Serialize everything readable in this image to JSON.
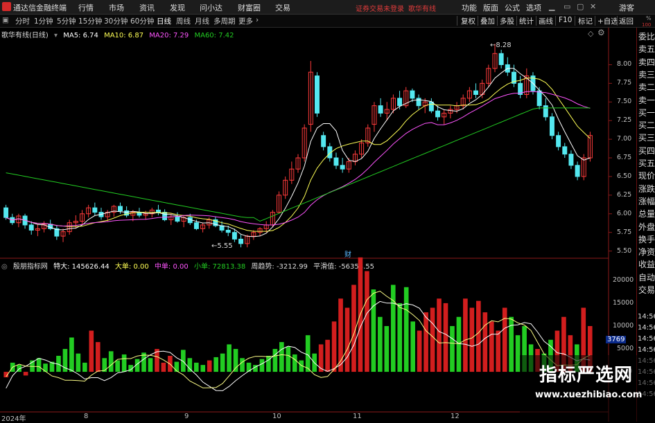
{
  "titlebar": {
    "app_title": "通达信金融终端",
    "menu": [
      "行情",
      "市场",
      "资讯",
      "发现",
      "问小达",
      "财富圈",
      "交易"
    ],
    "notice": "证券交易未登录",
    "stock_name": "歌华有线",
    "right_menu": [
      "功能",
      "版面",
      "公式",
      "选项"
    ],
    "guest": "游客"
  },
  "toolbar": {
    "periods": [
      "分时",
      "1分钟",
      "5分钟",
      "15分钟",
      "30分钟",
      "60分钟",
      "日线",
      "周线",
      "月线",
      "多周期",
      "更多"
    ],
    "active_period": "日线",
    "right_buttons": [
      "复权",
      "叠加",
      "多股",
      "统计",
      "画线",
      "F10",
      "标记",
      "+自选",
      "返回"
    ]
  },
  "main_chart": {
    "stock_title": "歌华有线(日线)",
    "ma5": "MA5: 6.74",
    "ma10": "MA10: 6.87",
    "ma20": "MA20: 7.29",
    "ma60": "MA60: 7.42",
    "high_marker": "8.28",
    "low_marker": "5.55",
    "event_marker": "财",
    "y_ticks": [
      "8.00",
      "7.75",
      "7.50",
      "7.25",
      "7.00",
      "6.75",
      "6.50",
      "6.25",
      "6.00",
      "5.75",
      "5.50"
    ],
    "corner_labels": [
      "%",
      "100"
    ]
  },
  "sub_chart": {
    "title": "殷朋指标网",
    "tedа": "特大: 145626.44",
    "dadan": "大单: 0.00",
    "zhongdan": "中单: 0.00",
    "xiaodan": "小单: 72813.38",
    "zhouqushi": "周趋势: -3212.99",
    "pinghuazhi": "平滑值: -56353.55",
    "y_ticks": [
      "20000",
      "15000",
      "10000",
      "5000",
      "0"
    ],
    "highlight_value": "3769"
  },
  "x_axis": [
    "2024年",
    "8",
    "9",
    "10",
    "11",
    "12"
  ],
  "right_panel": {
    "items": [
      "委比",
      "卖五",
      "卖四",
      "卖三",
      "卖二",
      "卖一",
      "买一",
      "买二",
      "买三",
      "买四",
      "买五",
      "现价",
      "涨跌",
      "涨幅",
      "总量",
      "外盘",
      "换手",
      "净资",
      "收益",
      "自动",
      "交易"
    ],
    "times": [
      "14:56",
      "14:56",
      "14:56",
      "14:56",
      "14:56",
      "14:56",
      "14:56",
      "14:56"
    ]
  },
  "watermark": {
    "line1": "指标严选网",
    "line2": "www.xuezhibiao.com"
  },
  "colors": {
    "up": "#ff3b3b",
    "down": "#54e8f0",
    "ma5": "#ffffff",
    "ma10": "#ffff55",
    "ma20": "#ff55ff",
    "ma60": "#22cc22",
    "vol_red": "#d21e1e",
    "vol_green": "#22cc22"
  },
  "chart_data": [
    {
      "type": "candlestick",
      "title": "歌华有线(日线)",
      "x_labels": [
        "2024年",
        "8",
        "9",
        "10",
        "11",
        "12"
      ],
      "ylim": [
        5.45,
        8.45
      ],
      "ohlc": [
        [
          6.08,
          6.12,
          5.92,
          5.95
        ],
        [
          5.95,
          6.0,
          5.85,
          5.88
        ],
        [
          5.88,
          6.0,
          5.82,
          5.97
        ],
        [
          5.97,
          6.0,
          5.8,
          5.85
        ],
        [
          5.85,
          5.9,
          5.72,
          5.78
        ],
        [
          5.78,
          5.86,
          5.7,
          5.8
        ],
        [
          5.8,
          5.9,
          5.75,
          5.86
        ],
        [
          5.86,
          5.92,
          5.78,
          5.8
        ],
        [
          5.8,
          5.85,
          5.65,
          5.7
        ],
        [
          5.7,
          5.8,
          5.62,
          5.76
        ],
        [
          5.76,
          5.92,
          5.72,
          5.88
        ],
        [
          5.88,
          5.98,
          5.8,
          5.9
        ],
        [
          5.9,
          6.05,
          5.85,
          6.0
        ],
        [
          6.0,
          6.12,
          5.95,
          6.08
        ],
        [
          6.08,
          6.15,
          5.98,
          6.02
        ],
        [
          6.02,
          6.08,
          5.92,
          5.96
        ],
        [
          5.96,
          6.05,
          5.9,
          6.02
        ],
        [
          6.02,
          6.12,
          5.96,
          6.1
        ],
        [
          6.1,
          6.15,
          6.0,
          6.04
        ],
        [
          6.04,
          6.1,
          5.95,
          5.98
        ],
        [
          5.98,
          6.05,
          5.9,
          6.02
        ],
        [
          6.02,
          6.08,
          5.95,
          5.98
        ],
        [
          5.98,
          6.04,
          5.92,
          6.0
        ],
        [
          6.0,
          6.08,
          5.95,
          6.05
        ],
        [
          6.05,
          6.12,
          5.98,
          6.02
        ],
        [
          6.02,
          6.06,
          5.9,
          5.92
        ],
        [
          5.92,
          6.0,
          5.85,
          5.96
        ],
        [
          5.96,
          6.02,
          5.88,
          5.9
        ],
        [
          5.9,
          5.98,
          5.82,
          5.95
        ],
        [
          5.95,
          6.0,
          5.85,
          5.88
        ],
        [
          5.88,
          5.92,
          5.78,
          5.8
        ],
        [
          5.8,
          5.88,
          5.75,
          5.85
        ],
        [
          5.85,
          5.95,
          5.8,
          5.92
        ],
        [
          5.92,
          5.96,
          5.82,
          5.84
        ],
        [
          5.84,
          5.9,
          5.75,
          5.78
        ],
        [
          5.78,
          5.84,
          5.7,
          5.75
        ],
        [
          5.75,
          5.8,
          5.62,
          5.66
        ],
        [
          5.66,
          5.72,
          5.55,
          5.6
        ],
        [
          5.6,
          5.72,
          5.55,
          5.7
        ],
        [
          5.7,
          5.78,
          5.65,
          5.75
        ],
        [
          5.75,
          5.82,
          5.7,
          5.8
        ],
        [
          5.8,
          5.9,
          5.75,
          5.85
        ],
        [
          5.85,
          6.05,
          5.82,
          6.02
        ],
        [
          6.02,
          6.3,
          6.0,
          6.25
        ],
        [
          6.25,
          6.5,
          6.2,
          6.45
        ],
        [
          6.45,
          6.7,
          6.4,
          6.6
        ],
        [
          6.6,
          6.8,
          6.55,
          6.75
        ],
        [
          6.75,
          7.2,
          6.7,
          7.15
        ],
        [
          7.2,
          8.05,
          7.1,
          7.9
        ],
        [
          7.85,
          7.9,
          7.3,
          7.35
        ],
        [
          7.05,
          7.1,
          6.85,
          6.9
        ],
        [
          6.9,
          6.95,
          6.7,
          6.75
        ],
        [
          6.75,
          6.82,
          6.6,
          6.65
        ],
        [
          6.65,
          6.75,
          6.55,
          6.6
        ],
        [
          6.6,
          6.75,
          6.55,
          6.7
        ],
        [
          6.7,
          6.85,
          6.65,
          6.8
        ],
        [
          6.8,
          7.0,
          6.75,
          6.95
        ],
        [
          6.95,
          7.2,
          6.9,
          7.15
        ],
        [
          7.2,
          7.5,
          7.1,
          7.45
        ],
        [
          7.45,
          7.55,
          7.3,
          7.35
        ],
        [
          7.35,
          7.5,
          7.25,
          7.4
        ],
        [
          7.4,
          7.6,
          7.35,
          7.55
        ],
        [
          7.55,
          7.65,
          7.4,
          7.45
        ],
        [
          7.45,
          7.7,
          7.42,
          7.65
        ],
        [
          7.65,
          7.68,
          7.5,
          7.55
        ],
        [
          7.55,
          7.6,
          7.4,
          7.45
        ],
        [
          7.45,
          7.55,
          7.35,
          7.5
        ],
        [
          7.5,
          7.55,
          7.35,
          7.38
        ],
        [
          7.38,
          7.45,
          7.25,
          7.3
        ],
        [
          7.3,
          7.4,
          7.2,
          7.35
        ],
        [
          7.35,
          7.45,
          7.28,
          7.4
        ],
        [
          7.4,
          7.5,
          7.35,
          7.45
        ],
        [
          7.45,
          7.6,
          7.4,
          7.55
        ],
        [
          7.55,
          7.7,
          7.5,
          7.65
        ],
        [
          7.65,
          7.75,
          7.55,
          7.6
        ],
        [
          7.6,
          7.8,
          7.55,
          7.75
        ],
        [
          7.75,
          8.0,
          7.7,
          7.95
        ],
        [
          7.95,
          8.28,
          7.9,
          8.15
        ],
        [
          8.15,
          8.2,
          7.95,
          8.0
        ],
        [
          8.0,
          8.1,
          7.85,
          7.9
        ],
        [
          7.9,
          8.0,
          7.7,
          7.75
        ],
        [
          7.75,
          7.85,
          7.55,
          7.6
        ],
        [
          7.6,
          7.95,
          7.55,
          7.85
        ],
        [
          7.85,
          7.9,
          7.6,
          7.65
        ],
        [
          7.65,
          7.7,
          7.4,
          7.45
        ],
        [
          7.45,
          7.55,
          7.25,
          7.3
        ],
        [
          7.3,
          7.35,
          7.0,
          7.05
        ],
        [
          7.05,
          7.1,
          6.85,
          6.9
        ],
        [
          6.9,
          6.95,
          6.75,
          6.8
        ],
        [
          6.8,
          6.85,
          6.6,
          6.65
        ],
        [
          6.65,
          6.7,
          6.45,
          6.5
        ],
        [
          6.5,
          6.8,
          6.45,
          6.75
        ],
        [
          6.75,
          7.1,
          6.7,
          7.05
        ]
      ],
      "series": [
        {
          "name": "MA5",
          "value": 6.74
        },
        {
          "name": "MA10",
          "value": 6.87
        },
        {
          "name": "MA20",
          "value": 7.29
        },
        {
          "name": "MA60",
          "value": 7.42
        }
      ]
    },
    {
      "type": "bar",
      "title": "殷朋指标网",
      "ylim": [
        -8000,
        23000
      ],
      "bars": [
        [
          -1200,
          "r"
        ],
        [
          2000,
          "g"
        ],
        [
          1500,
          "g"
        ],
        [
          -800,
          "r"
        ],
        [
          2500,
          "g"
        ],
        [
          3000,
          "g"
        ],
        [
          1800,
          "g"
        ],
        [
          2200,
          "g"
        ],
        [
          3500,
          "g"
        ],
        [
          5000,
          "g"
        ],
        [
          7500,
          "g"
        ],
        [
          4000,
          "g"
        ],
        [
          2000,
          "g"
        ],
        [
          9000,
          "r"
        ],
        [
          6500,
          "r"
        ],
        [
          3000,
          "g"
        ],
        [
          4500,
          "g"
        ],
        [
          2500,
          "g"
        ],
        [
          3800,
          "g"
        ],
        [
          1500,
          "g"
        ],
        [
          2800,
          "g"
        ],
        [
          4200,
          "g"
        ],
        [
          3000,
          "g"
        ],
        [
          5000,
          "r"
        ],
        [
          2000,
          "r"
        ],
        [
          3500,
          "r"
        ],
        [
          2200,
          "g"
        ],
        [
          4800,
          "g"
        ],
        [
          3000,
          "g"
        ],
        [
          2000,
          "g"
        ],
        [
          1500,
          "g"
        ],
        [
          2500,
          "r"
        ],
        [
          3200,
          "g"
        ],
        [
          4000,
          "g"
        ],
        [
          6000,
          "g"
        ],
        [
          5000,
          "g"
        ],
        [
          3000,
          "g"
        ],
        [
          2000,
          "g"
        ],
        [
          1500,
          "g"
        ],
        [
          2800,
          "g"
        ],
        [
          3500,
          "g"
        ],
        [
          5000,
          "g"
        ],
        [
          6500,
          "g"
        ],
        [
          5500,
          "g"
        ],
        [
          3800,
          "g"
        ],
        [
          2500,
          "g"
        ],
        [
          8000,
          "g"
        ],
        [
          4000,
          "g"
        ],
        [
          6000,
          "r"
        ],
        [
          7000,
          "r"
        ],
        [
          11000,
          "r"
        ],
        [
          16000,
          "r"
        ],
        [
          14000,
          "r"
        ],
        [
          19000,
          "r"
        ],
        [
          25000,
          "r"
        ],
        [
          22000,
          "r"
        ],
        [
          18000,
          "g"
        ],
        [
          12000,
          "g"
        ],
        [
          10000,
          "g"
        ],
        [
          19000,
          "g"
        ],
        [
          15000,
          "g"
        ],
        [
          18500,
          "g"
        ],
        [
          11000,
          "g"
        ],
        [
          9000,
          "r"
        ],
        [
          13000,
          "r"
        ],
        [
          14000,
          "r"
        ],
        [
          16000,
          "r"
        ],
        [
          15000,
          "r"
        ],
        [
          10000,
          "g"
        ],
        [
          12000,
          "g"
        ],
        [
          16000,
          "r"
        ],
        [
          14000,
          "r"
        ],
        [
          15500,
          "r"
        ],
        [
          13000,
          "r"
        ],
        [
          11000,
          "r"
        ],
        [
          9000,
          "r"
        ],
        [
          14000,
          "r"
        ],
        [
          12000,
          "g"
        ],
        [
          8000,
          "g"
        ],
        [
          10000,
          "g"
        ],
        [
          6000,
          "g"
        ],
        [
          5000,
          "r"
        ],
        [
          4000,
          "g"
        ],
        [
          7000,
          "g"
        ],
        [
          9000,
          "r"
        ],
        [
          12000,
          "r"
        ],
        [
          8000,
          "r"
        ],
        [
          6000,
          "g"
        ],
        [
          14000,
          "r"
        ],
        [
          10000,
          "r"
        ]
      ]
    }
  ]
}
